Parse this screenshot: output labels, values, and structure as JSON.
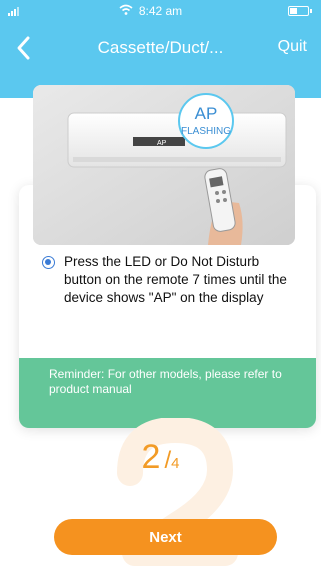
{
  "status_bar": {
    "time": "8:42 am"
  },
  "header": {
    "title": "Cassette/Duct/...",
    "quit_label": "Quit"
  },
  "illustration": {
    "bubble_line1": "AP",
    "bubble_line2": "FLASHING",
    "unit_display": "AP"
  },
  "instruction": {
    "selected": true,
    "text": "Press the LED or Do Not Disturb button on the remote 7 times until the device shows \"AP\" on the display"
  },
  "reminder": {
    "text": "Reminder: For other models, please refer to product manual"
  },
  "progress": {
    "current": "2",
    "separator": "/",
    "total": "4"
  },
  "footer": {
    "next_label": "Next"
  },
  "colors": {
    "header": "#5bc8ef",
    "accent": "#f5921f",
    "reminder": "#5cc394",
    "radio": "#3a7bd5"
  },
  "icons": [
    "signal-icon",
    "wifi-icon",
    "battery-icon",
    "back-chevron-icon",
    "radio-selected-icon"
  ]
}
